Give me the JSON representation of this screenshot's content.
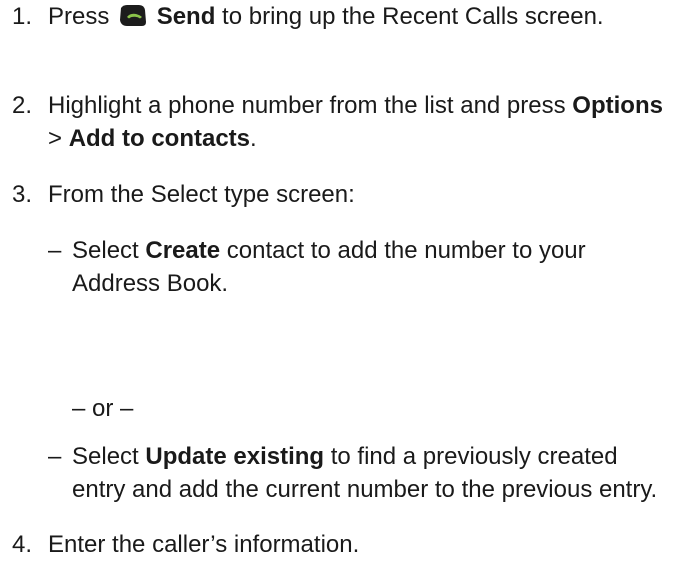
{
  "steps": [
    {
      "number": "1.",
      "pre": "Press ",
      "bold": "Send",
      "post": " to bring up the Recent Calls screen."
    },
    {
      "number": "2.",
      "pre": "Highlight a phone number from the list and press ",
      "bold1": "Options",
      "sep": " > ",
      "bold2": "Add to contacts",
      "post": "."
    },
    {
      "number": "3.",
      "text": "From the Select type screen:"
    },
    {
      "number": "4.",
      "text": "Enter the caller’s information."
    }
  ],
  "options": [
    {
      "dash": "–",
      "pre": "Select ",
      "bold": "Create",
      "post": " contact to add the number to your Address Book."
    },
    {
      "dash": "–",
      "pre": "Select ",
      "bold": "Update existing",
      "post": " to find a previously created entry and add the current number to the previous entry."
    }
  ],
  "or_text": "– or –",
  "icons": {
    "send": "send-key-icon",
    "send_key_color": "#2f4a23",
    "send_key_bg": "#1c1c1c",
    "send_handset_color": "#8bc34a"
  }
}
